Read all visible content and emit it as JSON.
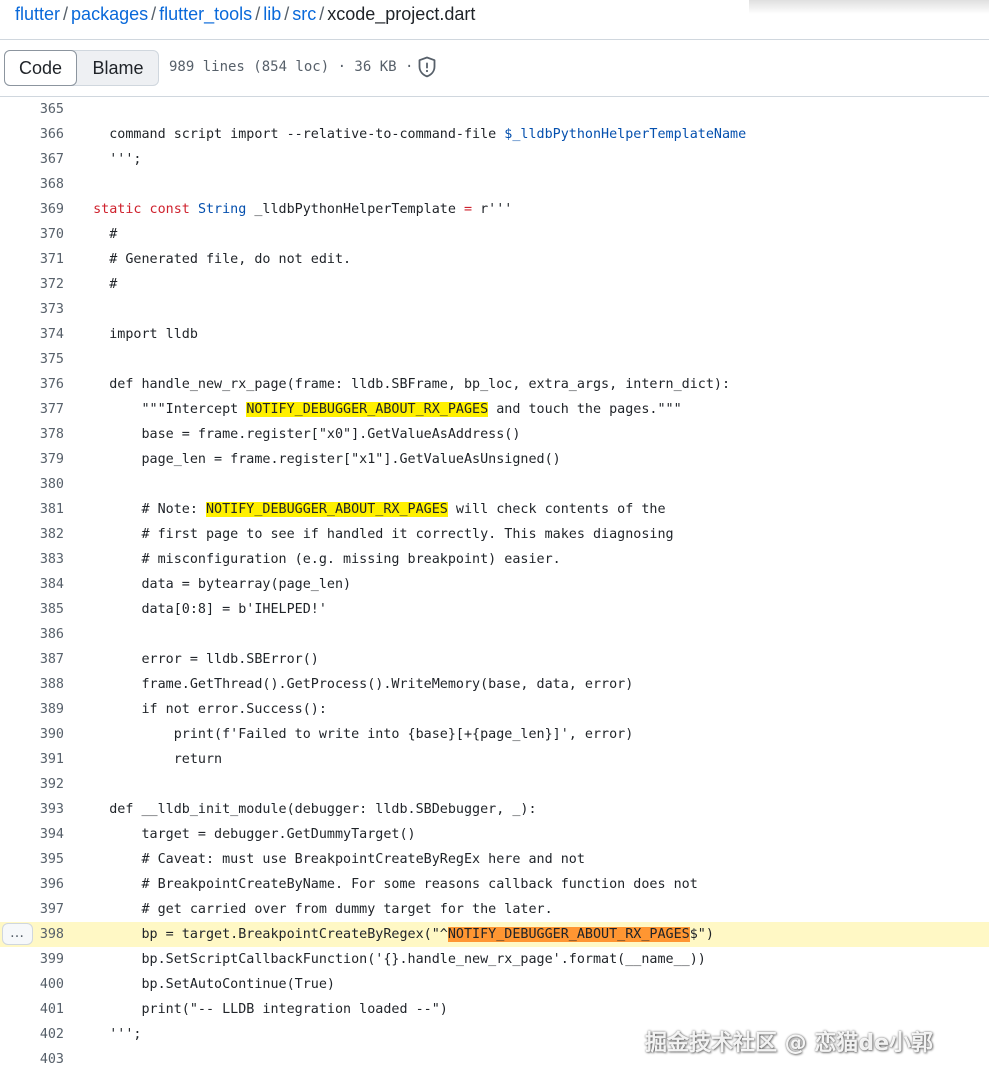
{
  "breadcrumb": {
    "items": [
      "flutter",
      "packages",
      "flutter_tools",
      "lib",
      "src"
    ],
    "separator": "/",
    "file": "xcode_project.dart"
  },
  "toolbar": {
    "code_label": "Code",
    "blame_label": "Blame",
    "file_info": "989 lines (854 loc) · 36 KB ·"
  },
  "code": {
    "line_actions_label": "…",
    "lines": [
      {
        "n": "365",
        "t": ""
      },
      {
        "n": "366",
        "t": "    command script import --relative-to-command-file $_lldbPythonHelperTemplateName"
      },
      {
        "n": "367",
        "t": "    ''';"
      },
      {
        "n": "368",
        "t": ""
      },
      {
        "n": "369",
        "t": "  static const String _lldbPythonHelperTemplate = r'''"
      },
      {
        "n": "370",
        "t": "    #"
      },
      {
        "n": "371",
        "t": "    # Generated file, do not edit."
      },
      {
        "n": "372",
        "t": "    #"
      },
      {
        "n": "373",
        "t": ""
      },
      {
        "n": "374",
        "t": "    import lldb"
      },
      {
        "n": "375",
        "t": ""
      },
      {
        "n": "376",
        "t": "    def handle_new_rx_page(frame: lldb.SBFrame, bp_loc, extra_args, intern_dict):"
      },
      {
        "n": "377",
        "t": "        \"\"\"Intercept NOTIFY_DEBUGGER_ABOUT_RX_PAGES and touch the pages.\"\"\""
      },
      {
        "n": "378",
        "t": "        base = frame.register[\"x0\"].GetValueAsAddress()"
      },
      {
        "n": "379",
        "t": "        page_len = frame.register[\"x1\"].GetValueAsUnsigned()"
      },
      {
        "n": "380",
        "t": ""
      },
      {
        "n": "381",
        "t": "        # Note: NOTIFY_DEBUGGER_ABOUT_RX_PAGES will check contents of the"
      },
      {
        "n": "382",
        "t": "        # first page to see if handled it correctly. This makes diagnosing"
      },
      {
        "n": "383",
        "t": "        # misconfiguration (e.g. missing breakpoint) easier."
      },
      {
        "n": "384",
        "t": "        data = bytearray(page_len)"
      },
      {
        "n": "385",
        "t": "        data[0:8] = b'IHELPED!'"
      },
      {
        "n": "386",
        "t": ""
      },
      {
        "n": "387",
        "t": "        error = lldb.SBError()"
      },
      {
        "n": "388",
        "t": "        frame.GetThread().GetProcess().WriteMemory(base, data, error)"
      },
      {
        "n": "389",
        "t": "        if not error.Success():"
      },
      {
        "n": "390",
        "t": "            print(f'Failed to write into {base}[+{page_len}]', error)"
      },
      {
        "n": "391",
        "t": "            return"
      },
      {
        "n": "392",
        "t": ""
      },
      {
        "n": "393",
        "t": "    def __lldb_init_module(debugger: lldb.SBDebugger, _):"
      },
      {
        "n": "394",
        "t": "        target = debugger.GetDummyTarget()"
      },
      {
        "n": "395",
        "t": "        # Caveat: must use BreakpointCreateByRegEx here and not"
      },
      {
        "n": "396",
        "t": "        # BreakpointCreateByName. For some reasons callback function does not"
      },
      {
        "n": "397",
        "t": "        # get carried over from dummy target for the later."
      },
      {
        "n": "398",
        "t": "        bp = target.BreakpointCreateByRegex(\"^NOTIFY_DEBUGGER_ABOUT_RX_PAGES$\")"
      },
      {
        "n": "399",
        "t": "        bp.SetScriptCallbackFunction('{}.handle_new_rx_page'.format(__name__))"
      },
      {
        "n": "400",
        "t": "        bp.SetAutoContinue(True)"
      },
      {
        "n": "401",
        "t": "        print(\"-- LLDB integration loaded --\")"
      },
      {
        "n": "402",
        "t": "    ''';"
      },
      {
        "n": "403",
        "t": ""
      }
    ]
  },
  "watermark": "掘金技术社区 @ 恋猫de小郭"
}
